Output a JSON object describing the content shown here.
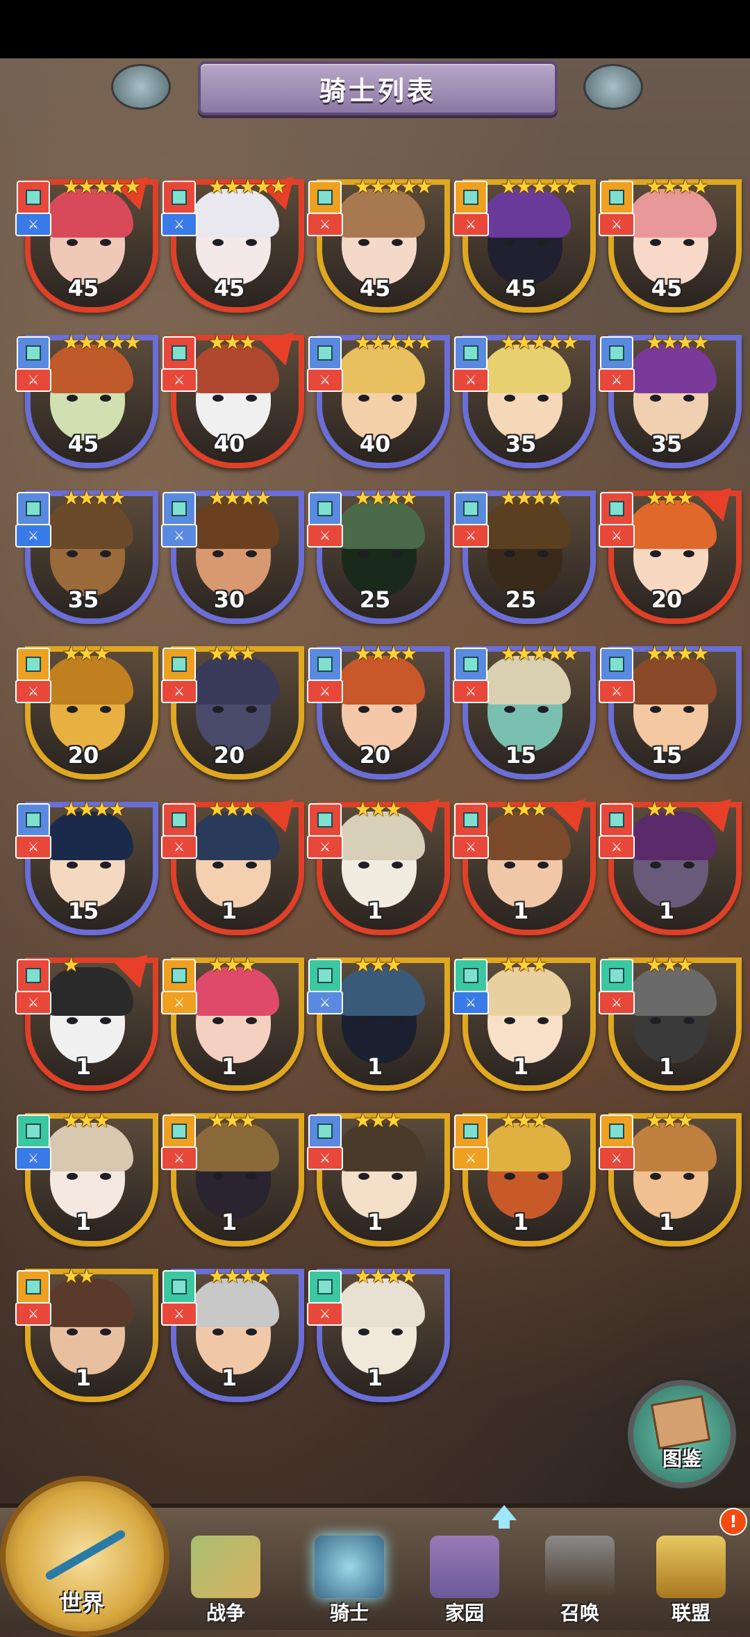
{
  "header": {
    "title": "骑士列表"
  },
  "knights": [
    {
      "level": "45",
      "tier": "red",
      "stars": "★★★★★",
      "class_color": "#e8483a",
      "role_color": "#3a7ae8",
      "face": "#f0c8b8",
      "hair": "#d84a5a",
      "corner": true
    },
    {
      "level": "45",
      "tier": "red",
      "stars": "★★★★★",
      "class_color": "#e8483a",
      "role_color": "#3a7ae8",
      "face": "#f4e8e8",
      "hair": "#e8e8ee",
      "corner": true
    },
    {
      "level": "45",
      "tier": "gold",
      "stars": "★★★★★",
      "class_color": "#f0a020",
      "role_color": "#e8483a",
      "face": "#f4d8c8",
      "hair": "#a87850",
      "corner": false
    },
    {
      "level": "45",
      "tier": "gold",
      "stars": "★★★★★",
      "class_color": "#f0a020",
      "role_color": "#e8483a",
      "face": "#202030",
      "hair": "#6a3a9a",
      "corner": false
    },
    {
      "level": "45",
      "tier": "gold",
      "stars": "★★★★",
      "class_color": "#f0a020",
      "role_color": "#e8483a",
      "face": "#f8d8c8",
      "hair": "#e89898",
      "corner": false
    },
    {
      "level": "45",
      "tier": "purple",
      "stars": "★★★★★",
      "class_color": "#5a8ae0",
      "role_color": "#e8483a",
      "face": "#d0e0b0",
      "hair": "#c05a2a",
      "corner": false
    },
    {
      "level": "40",
      "tier": "red",
      "stars": "★★★",
      "class_color": "#e8483a",
      "role_color": "#e8483a",
      "face": "#f0f0f0",
      "hair": "#b04830",
      "corner": true
    },
    {
      "level": "40",
      "tier": "purple",
      "stars": "★★★★★",
      "class_color": "#5a8ae0",
      "role_color": "#e8483a",
      "face": "#f4d0a8",
      "hair": "#e8c060",
      "corner": false
    },
    {
      "level": "35",
      "tier": "purple",
      "stars": "★★★★★",
      "class_color": "#5a8ae0",
      "role_color": "#e8483a",
      "face": "#f4d8b8",
      "hair": "#e8d070",
      "corner": false
    },
    {
      "level": "35",
      "tier": "purple",
      "stars": "★★★★",
      "class_color": "#5a8ae0",
      "role_color": "#e8483a",
      "face": "#f0d0b0",
      "hair": "#7a3a9a",
      "corner": false
    },
    {
      "level": "35",
      "tier": "purple",
      "stars": "★★★★",
      "class_color": "#5a8ae0",
      "role_color": "#3a7ae8",
      "face": "#9a6a3a",
      "hair": "#6a4a2a",
      "corner": false
    },
    {
      "level": "30",
      "tier": "purple",
      "stars": "★★★★",
      "class_color": "#5a8ae0",
      "role_color": "#5a8ae0",
      "face": "#d89870",
      "hair": "#6a4020",
      "corner": false
    },
    {
      "level": "25",
      "tier": "purple",
      "stars": "★★★★",
      "class_color": "#5a8ae0",
      "role_color": "#e8483a",
      "face": "#1a2a1a",
      "hair": "#4a6a4a",
      "corner": false
    },
    {
      "level": "25",
      "tier": "purple",
      "stars": "★★★★",
      "class_color": "#5a8ae0",
      "role_color": "#e8483a",
      "face": "#3a2a1a",
      "hair": "#5a4020",
      "corner": false
    },
    {
      "level": "20",
      "tier": "red",
      "stars": "★★★",
      "class_color": "#e8483a",
      "role_color": "#e8483a",
      "face": "#f8d8c0",
      "hair": "#e0682a",
      "corner": true
    },
    {
      "level": "20",
      "tier": "gold",
      "stars": "★★★",
      "class_color": "#f0a020",
      "role_color": "#e8483a",
      "face": "#e8b040",
      "hair": "#c08020",
      "corner": false
    },
    {
      "level": "20",
      "tier": "gold",
      "stars": "★★★",
      "class_color": "#f0a020",
      "role_color": "#e8483a",
      "face": "#4a4a6a",
      "hair": "#3a3a5a",
      "corner": false
    },
    {
      "level": "20",
      "tier": "purple",
      "stars": "★★★★",
      "class_color": "#5a8ae0",
      "role_color": "#e8483a",
      "face": "#f4c8a8",
      "hair": "#c8582a",
      "corner": false
    },
    {
      "level": "15",
      "tier": "purple",
      "stars": "★★★★★",
      "class_color": "#5a8ae0",
      "role_color": "#e8483a",
      "face": "#7ac0b0",
      "hair": "#d8d0b0",
      "corner": false
    },
    {
      "level": "15",
      "tier": "purple",
      "stars": "★★★★",
      "class_color": "#5a8ae0",
      "role_color": "#e8483a",
      "face": "#f4c8a0",
      "hair": "#8a4a2a",
      "corner": false
    },
    {
      "level": "15",
      "tier": "purple",
      "stars": "★★★★",
      "class_color": "#5a8ae0",
      "role_color": "#e8483a",
      "face": "#f4d8c0",
      "hair": "#1a2a4a",
      "corner": false
    },
    {
      "level": "1",
      "tier": "red",
      "stars": "★★★",
      "class_color": "#e8483a",
      "role_color": "#e8483a",
      "face": "#f4d0b0",
      "hair": "#2a3a5a",
      "corner": true
    },
    {
      "level": "1",
      "tier": "red",
      "stars": "★★★",
      "class_color": "#e8483a",
      "role_color": "#e8483a",
      "face": "#f0ece0",
      "hair": "#d8cfb8",
      "corner": true
    },
    {
      "level": "1",
      "tier": "red",
      "stars": "★★★",
      "class_color": "#e8483a",
      "role_color": "#e8483a",
      "face": "#f0c8a8",
      "hair": "#7a4a2a",
      "corner": true
    },
    {
      "level": "1",
      "tier": "red",
      "stars": "★★",
      "class_color": "#e8483a",
      "role_color": "#e8483a",
      "face": "#6a5a7a",
      "hair": "#5a2a6a",
      "corner": true
    },
    {
      "level": "1",
      "tier": "red",
      "stars": "★",
      "class_color": "#e8483a",
      "role_color": "#e8483a",
      "face": "#f0f0f0",
      "hair": "#2a2a2a",
      "corner": true
    },
    {
      "level": "1",
      "tier": "gold",
      "stars": "★★★",
      "class_color": "#f0a020",
      "role_color": "#f0a020",
      "face": "#f4d0c0",
      "hair": "#e04a6a",
      "corner": false
    },
    {
      "level": "1",
      "tier": "gold",
      "stars": "★★★",
      "class_color": "#3ac8a0",
      "role_color": "#5a8ae0",
      "face": "#1a2030",
      "hair": "#3a5a7a",
      "corner": false
    },
    {
      "level": "1",
      "tier": "gold",
      "stars": "★★★",
      "class_color": "#3ac8a0",
      "role_color": "#3a7ae8",
      "face": "#f8e0c8",
      "hair": "#e8d0a0",
      "corner": false
    },
    {
      "level": "1",
      "tier": "gold",
      "stars": "★★★",
      "class_color": "#3ac8a0",
      "role_color": "#e8483a",
      "face": "#3a3a3a",
      "hair": "#6a6a6a",
      "corner": false
    },
    {
      "level": "1",
      "tier": "gold",
      "stars": "★★★",
      "class_color": "#3ac8a0",
      "role_color": "#3a7ae8",
      "face": "#f4e8e0",
      "hair": "#d8c8b0",
      "corner": false
    },
    {
      "level": "1",
      "tier": "gold",
      "stars": "★★★",
      "class_color": "#f0a020",
      "role_color": "#e8483a",
      "face": "#2a2430",
      "hair": "#8a6a3a",
      "corner": false
    },
    {
      "level": "1",
      "tier": "gold",
      "stars": "★★★",
      "class_color": "#5a8ae0",
      "role_color": "#e8483a",
      "face": "#f4e0c8",
      "hair": "#4a3a2a",
      "corner": false
    },
    {
      "level": "1",
      "tier": "gold",
      "stars": "★★★",
      "class_color": "#f0a020",
      "role_color": "#f0a020",
      "face": "#c85a2a",
      "hair": "#e0b040",
      "corner": false
    },
    {
      "level": "1",
      "tier": "gold",
      "stars": "★★★",
      "class_color": "#f0a020",
      "role_color": "#e8483a",
      "face": "#f0c090",
      "hair": "#c08040",
      "corner": false
    },
    {
      "level": "1",
      "tier": "gold",
      "stars": "★★",
      "class_color": "#f0a020",
      "role_color": "#e8483a",
      "face": "#e8c0a0",
      "hair": "#5a3a2a",
      "corner": false
    },
    {
      "level": "1",
      "tier": "purple",
      "stars": "★★★★",
      "class_color": "#3ac8a0",
      "role_color": "#e8483a",
      "face": "#f0c8a8",
      "hair": "#c8c8c8",
      "corner": false
    },
    {
      "level": "1",
      "tier": "purple",
      "stars": "★★★★",
      "class_color": "#3ac8a0",
      "role_color": "#e8483a",
      "face": "#f0e8d8",
      "hair": "#e8e0d0",
      "corner": false
    }
  ],
  "catalog": {
    "label": "图鉴"
  },
  "nav": {
    "world": "世界",
    "war": "战争",
    "knights": "骑士",
    "home": "家园",
    "summon": "召唤",
    "alliance": "联盟",
    "alliance_badge": "!"
  },
  "colors": {
    "accent_gold": "#e0a820",
    "accent_red": "#e04028",
    "accent_purple": "#6a6ed6"
  }
}
